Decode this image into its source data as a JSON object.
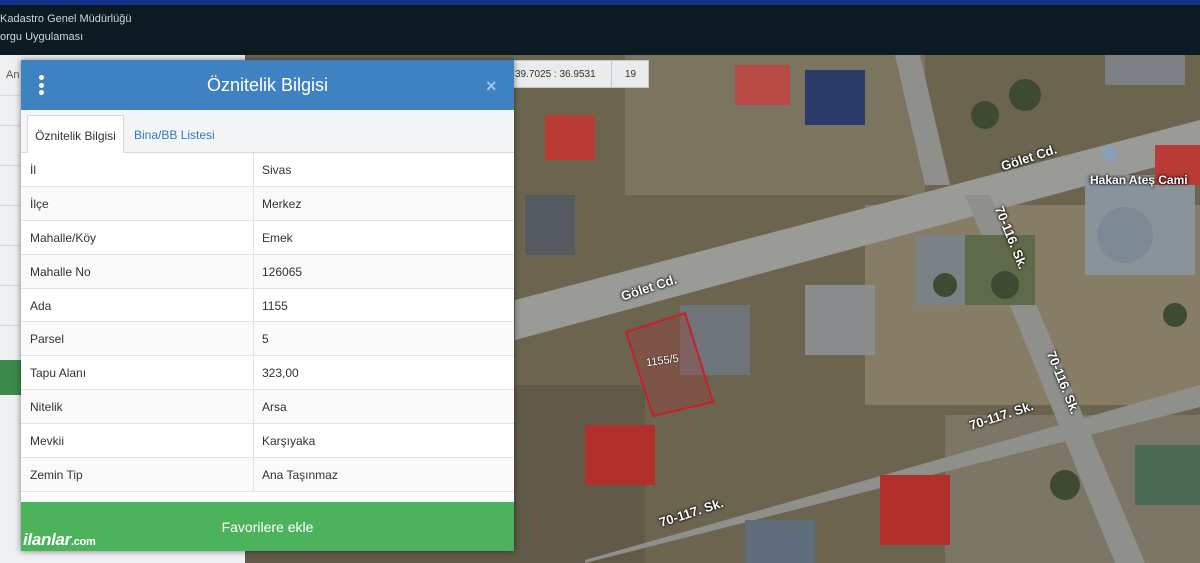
{
  "header": {
    "line1": "Kadastro Genel Müdürlüğü",
    "line2": "orgu Uygulaması"
  },
  "sidebar": {
    "partial_text": "An"
  },
  "coordinates": {
    "value": "39.7025 : 36.9531",
    "zoom": "19"
  },
  "panel": {
    "title": "Öznitelik Bilgisi",
    "close_icon": "close-icon",
    "tabs": [
      {
        "label": "Öznitelik Bilgisi",
        "active": true
      },
      {
        "label": "Bina/BB Listesi",
        "active": false
      }
    ],
    "rows": [
      {
        "key": "İl",
        "value": "Sivas"
      },
      {
        "key": "İlçe",
        "value": "Merkez"
      },
      {
        "key": "Mahalle/Köy",
        "value": "Emek"
      },
      {
        "key": "Mahalle No",
        "value": "126065"
      },
      {
        "key": "Ada",
        "value": "1155"
      },
      {
        "key": "Parsel",
        "value": "5"
      },
      {
        "key": "Tapu Alanı",
        "value": "323,00"
      },
      {
        "key": "Nitelik",
        "value": "Arsa"
      },
      {
        "key": "Mevkii",
        "value": "Karşıyaka"
      },
      {
        "key": "Zemin Tip",
        "value": "Ana Taşınmaz"
      }
    ],
    "favorite_button": "Favorilere ekle"
  },
  "watermark": {
    "brand": "ilanlar",
    "suffix": ".com"
  },
  "map": {
    "street_labels": [
      "Gölet Cd.",
      "Gölet Cd.",
      "70-116. Sk.",
      "70-116. Sk.",
      "70-117. Sk.",
      "70-117. Sk."
    ],
    "poi": "Hakan Ateş Cami",
    "parcel_label": "1155/5",
    "parcel_color": "#c8202a"
  }
}
